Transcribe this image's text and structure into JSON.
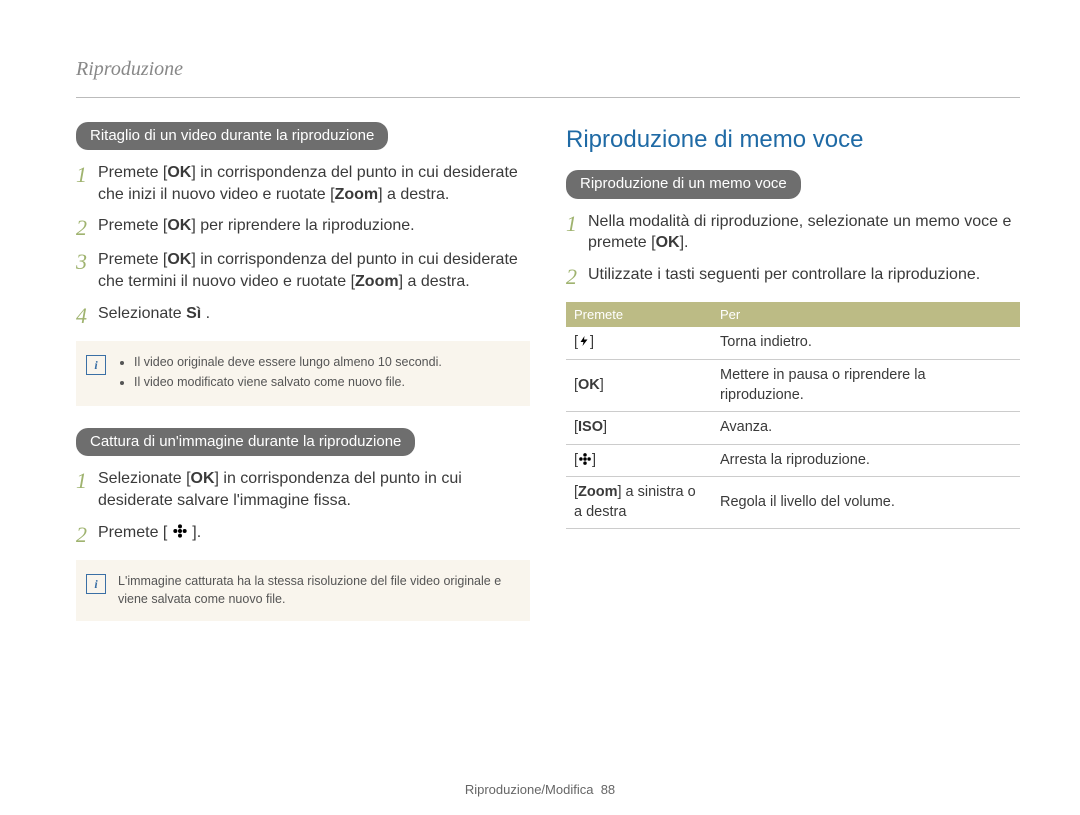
{
  "chapter_head": "Riproduzione",
  "footer": {
    "label": "Riproduzione/Modifica",
    "page": "88"
  },
  "left": {
    "pill1": "Ritaglio di un video durante la riproduzione",
    "steps1": [
      {
        "pre": "Premete [",
        "btn": "OK",
        "post": "] in corrispondenza del punto in cui desiderate che inizi il nuovo video e ruotate [",
        "bold": "Zoom",
        "post2": "] a destra."
      },
      {
        "pre": "Premete [",
        "btn": "OK",
        "post": "] per riprendere la riproduzione."
      },
      {
        "pre": "Premete [",
        "btn": "OK",
        "post": "] in corrispondenza del punto in cui desiderate che termini il nuovo video e ruotate [",
        "bold": "Zoom",
        "post2": "] a destra."
      },
      {
        "pre": "Selezionate ",
        "bold": "Sì",
        "post": " ."
      }
    ],
    "note1": [
      "Il video originale deve essere lungo almeno 10 secondi.",
      "Il video modificato viene salvato come nuovo file."
    ],
    "pill2": "Cattura di un'immagine durante la riproduzione",
    "steps2": [
      {
        "pre": "Selezionate [",
        "btn": "OK",
        "post": "] in corrispondenza del punto in cui desiderate salvare l'immagine fissa."
      },
      {
        "pre": "Premete [",
        "btn": "FLOWER",
        "post": "]."
      }
    ],
    "note2_text": "L'immagine catturata ha la stessa risoluzione del file video originale e viene salvata come nuovo file."
  },
  "right": {
    "section_title": "Riproduzione di memo voce",
    "pill": "Riproduzione di un memo voce",
    "steps": [
      {
        "pre": "Nella modalità di riproduzione, selezionate un memo voce e premete [",
        "btn": "OK",
        "post": "]."
      },
      {
        "pre": "Utilizzate i tasti seguenti per controllare la riproduzione."
      }
    ],
    "table": {
      "headers": [
        "Premete",
        "Per"
      ],
      "rows": [
        {
          "key": "[FLASH]",
          "desc": "Torna indietro."
        },
        {
          "key": "[OK]",
          "desc": "Mettere in pausa o riprendere la riproduzione."
        },
        {
          "key": "[ISO]",
          "desc": "Avanza."
        },
        {
          "key": "[FLOWER]",
          "desc": "Arresta la riproduzione."
        },
        {
          "key_html": "[<b>Zoom</b>] a sinistra o a destra",
          "desc": "Regola il livello del volume."
        }
      ]
    }
  },
  "glyphs": {
    "OK": "OK",
    "ISO": "ISO"
  }
}
